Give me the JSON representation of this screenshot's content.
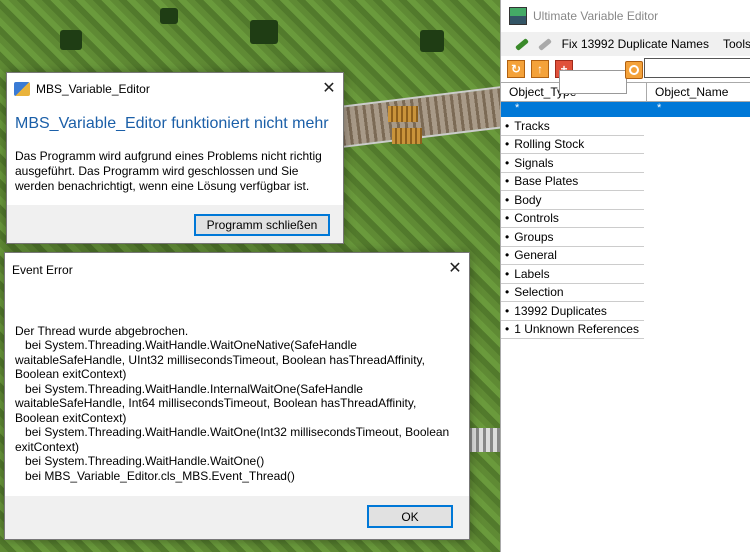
{
  "background": {
    "description_icon": "game-terrain"
  },
  "uve": {
    "title": "Ultimate Variable Editor",
    "menu": {
      "fix_label": "Fix 13992 Duplicate Names",
      "tools_label": "Tools"
    },
    "toolbar": {
      "refresh_icon": "refresh-icon",
      "up_icon": "up-arrow-icon",
      "add_label": "+",
      "search_value": ""
    },
    "grid": {
      "headers": [
        "Object_Type",
        "Object_Name"
      ],
      "filter_row": {
        "type": "*",
        "name": "*"
      },
      "rows": [
        "Tracks",
        "Rolling Stock",
        "Signals",
        "Base Plates",
        "Body",
        "Controls",
        "Groups",
        "General",
        "Labels",
        "Selection",
        "13992 Duplicates",
        "1 Unknown References"
      ]
    }
  },
  "crash_dialog": {
    "title": "MBS_Variable_Editor",
    "heading": "MBS_Variable_Editor funktioniert nicht mehr",
    "message": "Das Programm wird aufgrund eines Problems nicht richtig ausgeführt. Das Programm wird geschlossen und Sie werden benachrichtigt, wenn eine Lösung verfügbar ist.",
    "button": "Programm schließen"
  },
  "event_error": {
    "title": "Event Error",
    "lines": [
      "Der Thread wurde abgebrochen.",
      "   bei System.Threading.WaitHandle.WaitOneNative(SafeHandle waitableSafeHandle, UInt32 millisecondsTimeout, Boolean hasThreadAffinity, Boolean exitContext)",
      "   bei System.Threading.WaitHandle.InternalWaitOne(SafeHandle waitableSafeHandle, Int64 millisecondsTimeout, Boolean hasThreadAffinity, Boolean exitContext)",
      "   bei System.Threading.WaitHandle.WaitOne(Int32 millisecondsTimeout, Boolean exitContext)",
      "   bei System.Threading.WaitHandle.WaitOne()",
      "   bei MBS_Variable_Editor.cls_MBS.Event_Thread()"
    ],
    "button": "OK"
  }
}
